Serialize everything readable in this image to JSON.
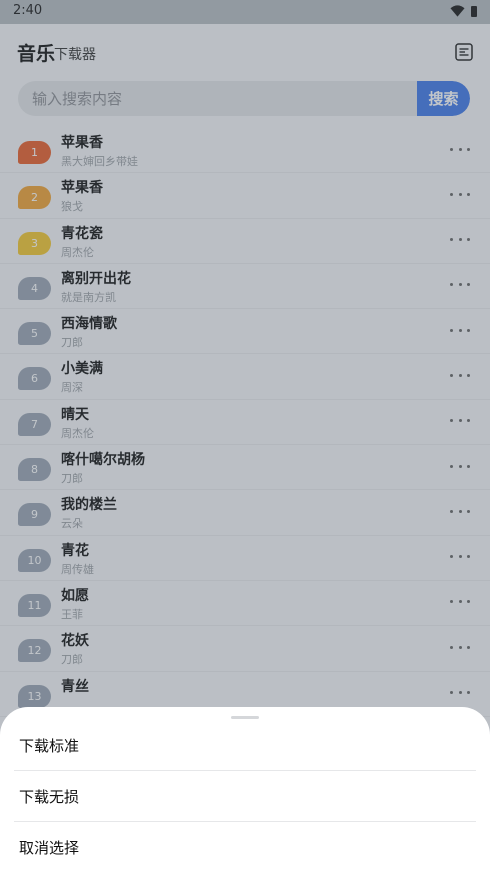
{
  "status_bar": {
    "time": "2:40"
  },
  "header": {
    "title": "音乐",
    "subtitle": "下载器",
    "icon": "menu-list-icon"
  },
  "search": {
    "placeholder": "输入搜索内容",
    "value": "",
    "button_label": "搜索"
  },
  "colors": {
    "accent": "#3f79e8",
    "rank1": "#e85f2a",
    "rank2": "#f0a233",
    "rank3": "#f3c62f",
    "rank_default": "#9aa4b3"
  },
  "songs": [
    {
      "rank": "1",
      "title": "苹果香",
      "artist": "黑大婶回乡带娃"
    },
    {
      "rank": "2",
      "title": "苹果香",
      "artist": "狼戈"
    },
    {
      "rank": "3",
      "title": "青花瓷",
      "artist": "周杰伦"
    },
    {
      "rank": "4",
      "title": "离别开出花",
      "artist": "就是南方凯"
    },
    {
      "rank": "5",
      "title": "西海情歌",
      "artist": "刀郎"
    },
    {
      "rank": "6",
      "title": "小美满",
      "artist": "周深"
    },
    {
      "rank": "7",
      "title": "晴天",
      "artist": "周杰伦"
    },
    {
      "rank": "8",
      "title": "喀什噶尔胡杨",
      "artist": "刀郎"
    },
    {
      "rank": "9",
      "title": "我的楼兰",
      "artist": "云朵"
    },
    {
      "rank": "10",
      "title": "青花",
      "artist": "周传雄"
    },
    {
      "rank": "11",
      "title": "如愿",
      "artist": "王菲"
    },
    {
      "rank": "12",
      "title": "花妖",
      "artist": "刀郎"
    },
    {
      "rank": "13",
      "title": "青丝",
      "artist": ""
    }
  ],
  "sheet": {
    "options": [
      {
        "label": "下载标准"
      },
      {
        "label": "下载无损"
      },
      {
        "label": "取消选择"
      }
    ]
  }
}
